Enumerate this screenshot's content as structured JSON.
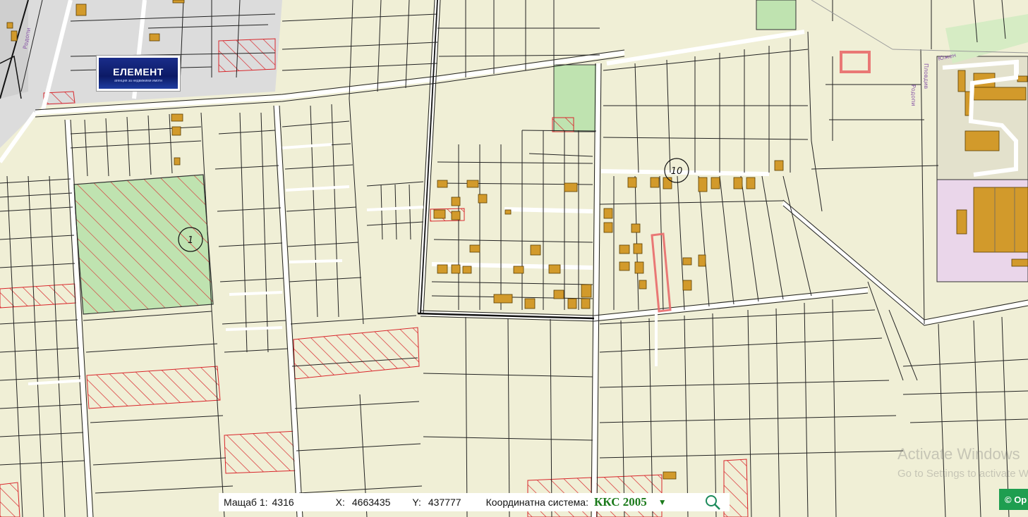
{
  "map": {
    "plot_labels": [
      "1",
      "10"
    ],
    "street_labels": [
      "Родопи",
      "Пловдив",
      "Родопи",
      "Южен"
    ],
    "colors": {
      "background": "#f0efd6",
      "parcel_line": "#222222",
      "green_area": "#bfe3b0",
      "hatch_red": "#d8262b",
      "building": "#d29a2b",
      "road_fill": "#ffffff",
      "highlight": "#e86a6a",
      "industrial_pink": "#ead6ea",
      "urban_gray": "#dcdcdc"
    }
  },
  "logo": {
    "title": "ЕЛЕМЕНТ",
    "subtitle": "агенция за недвижими имоти"
  },
  "watermark": {
    "line1": "Activate Windows",
    "line2": "Go to Settings to activate Windows."
  },
  "toolbar": {
    "scale_label": "Мащаб 1:",
    "scale_value": "4316",
    "x_label": "X:",
    "x_value": "4663435",
    "y_label": "Y:",
    "y_value": "437777",
    "coord_system_label": "Координатна система:",
    "coord_system_value": "ККС 2005",
    "dropdown_icon": "chevron-down-icon",
    "search_icon": "search-icon"
  },
  "copyright": {
    "label": "© Op",
    "icon": "copyright-icon"
  }
}
